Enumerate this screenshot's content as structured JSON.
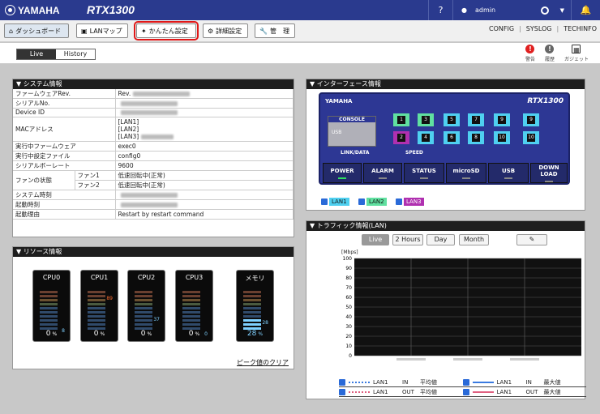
{
  "header": {
    "brand": "YAMAHA",
    "model": "RTX1300",
    "help": "?",
    "user": "admin"
  },
  "nav": {
    "dashboard": "ダッシュボード",
    "lanmap": "LANマップ",
    "easy_setup": "かんたん設定",
    "detail": "詳細設定",
    "manage": "管　理",
    "config": "CONFIG",
    "syslog": "SYSLOG",
    "techinfo": "TECHINFO"
  },
  "subnav": {
    "live": "Live",
    "history": "History",
    "alert": "警告",
    "info": "履歴",
    "gadget": "ガジェット"
  },
  "system": {
    "title": "システム情報",
    "rows": [
      {
        "label": "ファームウェアRev.",
        "value": "Rev."
      },
      {
        "label": "シリアルNo.",
        "value": ""
      },
      {
        "label": "Device ID",
        "value": ""
      },
      {
        "label": "MACアドレス",
        "value": "[LAN1]\n[LAN2]\n[LAN3]"
      },
      {
        "label": "実行中ファームウェア",
        "value": "exec0"
      },
      {
        "label": "実行中設定ファイル",
        "value": "config0"
      },
      {
        "label": "シリアルボーレート",
        "value": "9600"
      },
      {
        "label": "ファンの状態",
        "sub": "ファン1",
        "value": "低速回転中(正常)"
      },
      {
        "label": "",
        "sub": "ファン2",
        "value": "低速回転中(正常)"
      },
      {
        "label": "システム時刻",
        "value": ""
      },
      {
        "label": "起動時刻",
        "value": ""
      },
      {
        "label": "起動理由",
        "value": "Restart by restart command"
      }
    ]
  },
  "resource": {
    "title": "リソース情報",
    "meters": [
      {
        "name": "CPU0",
        "percent": "0",
        "peak": "8",
        "unit": "%"
      },
      {
        "name": "CPU1",
        "percent": "0",
        "peak": "89",
        "unit": "%"
      },
      {
        "name": "CPU2",
        "percent": "0",
        "peak": "37",
        "unit": "%"
      },
      {
        "name": "CPU3",
        "percent": "0",
        "peak": "0",
        "unit": "%"
      },
      {
        "name": "メモリ",
        "percent": "28",
        "peak": "28",
        "unit": "%"
      }
    ],
    "clear_peak": "ピーク値のクリア"
  },
  "interface": {
    "title": "インターフェース情報",
    "brand": "YAMAHA",
    "model": "RTX1300",
    "console": "CONSOLE",
    "usb": "USB",
    "link_data": "LINK/DATA",
    "speed": "SPEED",
    "ports": [
      "1",
      "2",
      "3",
      "4",
      "5",
      "6",
      "7",
      "8",
      "9",
      "10",
      "9",
      "10"
    ],
    "sections": [
      "POWER",
      "ALARM",
      "STATUS",
      "microSD",
      "USB",
      "DOWN LOAD"
    ],
    "lans": [
      {
        "name": "LAN1",
        "color": "#4fd0f0"
      },
      {
        "name": "LAN2",
        "color": "#60e0a0"
      },
      {
        "name": "LAN3",
        "color": "#b030b0"
      }
    ]
  },
  "traffic": {
    "title": "トラフィック情報(LAN)",
    "ranges": [
      "Live",
      "2 Hours",
      "Day",
      "Month"
    ],
    "unit": "[Mbps]",
    "yticks": [
      "100",
      "90",
      "80",
      "70",
      "60",
      "50",
      "40",
      "30",
      "20",
      "10",
      "0"
    ],
    "legend": [
      {
        "lan": "LAN1",
        "dir": "IN",
        "kind": "平均値",
        "lan2": "LAN1",
        "dir2": "IN",
        "kind2": "最大値"
      },
      {
        "lan": "LAN1",
        "dir": "OUT",
        "kind": "平均値",
        "lan2": "LAN1",
        "dir2": "OUT",
        "kind2": "最大値"
      }
    ]
  }
}
